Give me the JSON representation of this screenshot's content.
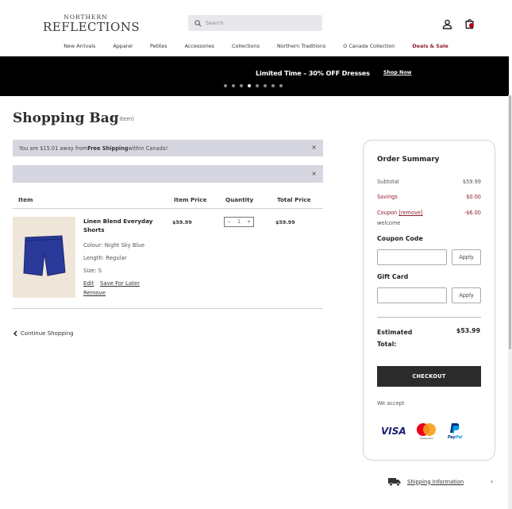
{
  "header": {
    "logo_top": "NORTHERN",
    "logo_bottom": "REFLECTIONS",
    "search_placeholder": "Search",
    "nav": [
      "New Arrivals",
      "Apparel",
      "Petites",
      "Accessories",
      "Collections",
      "Northern Traditions",
      "O Canada Collection",
      "Deals & Sale"
    ]
  },
  "banner": {
    "text": "Limited Time – 30% OFF Dresses",
    "link": "Shop Now",
    "dots_count": 8,
    "active_dot": 4
  },
  "page": {
    "title": "Shopping Bag",
    "item_count": "(1 item)"
  },
  "notices": {
    "shipping_prefix": "You are $15.01 away from ",
    "shipping_bold": "Free Shipping",
    "shipping_suffix": " within Canada!",
    "close_symbol": "×"
  },
  "table": {
    "headers": [
      "Item",
      "Item Price",
      "Quantity",
      "Total Price"
    ],
    "product": {
      "name": "Linen Blend Everyday Shorts",
      "colour": "Colour:  Night Sky Blue",
      "length": "Length:  Regular",
      "size": "Size:  S",
      "edit": "Edit",
      "save_later": "Save For Later",
      "remove": "Remove",
      "item_price": "$59.99",
      "quantity": "1",
      "qty_minus": "−",
      "qty_plus": "+",
      "total_price": "$59.99",
      "image_color": "#2a3a9a"
    }
  },
  "continue_shopping": "Continue Shopping",
  "summary": {
    "title": "Order Summary",
    "subtotal_label": "Subtotal",
    "subtotal_value": "$59.99",
    "savings_label": "Savings",
    "savings_value": "$0.00",
    "coupon_label": "Coupon",
    "coupon_remove": "[remove]",
    "coupon_value": "-$6.00",
    "coupon_code_name": "welcome",
    "coupon_code_label": "Coupon Code",
    "gift_card_label": "Gift Card",
    "apply_label": "Apply",
    "estimated_total_label": "Estimated Total:",
    "estimated_total_value": "$53.99",
    "checkout_label": "CHECKOUT",
    "we_accept": "We accept",
    "visa": "VISA",
    "mastercard": "mastercard",
    "paypal_pay": "Pay",
    "paypal_pal": "Pal"
  },
  "footer": {
    "shipping_info": "Shipping Information",
    "chevron": "›"
  },
  "colors": {
    "accent_red": "#8b1e2d",
    "banner_bg": "#000000",
    "notice_bg": "#d6d6e0",
    "checkout_bg": "#2b2b2b"
  }
}
